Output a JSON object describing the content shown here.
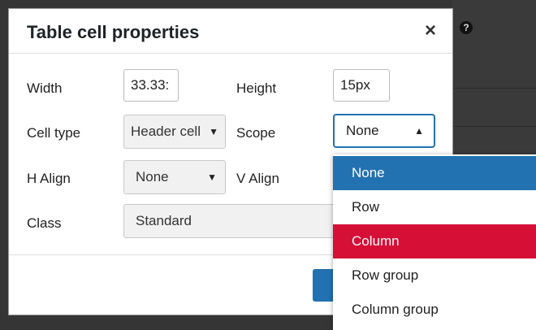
{
  "dialog": {
    "title": "Table cell properties",
    "close_label": "×"
  },
  "form": {
    "width_label": "Width",
    "width_value": "33.33:",
    "height_label": "Height",
    "height_value": "15px",
    "cell_type_label": "Cell type",
    "cell_type_value": "Header cell",
    "scope_label": "Scope",
    "scope_value": "None",
    "h_align_label": "H Align",
    "h_align_value": "None",
    "v_align_label": "V Align",
    "class_label": "Class",
    "class_value": "Standard"
  },
  "scope_options": [
    "None",
    "Row",
    "Column",
    "Row group",
    "Column group"
  ],
  "selected_option": "None",
  "highlighted_option": "Column",
  "icons": {
    "help": "?",
    "arrow_up": "▲",
    "arrow_down": "▼"
  },
  "colors": {
    "accent": "#2271b1",
    "highlight": "#d60f37"
  }
}
